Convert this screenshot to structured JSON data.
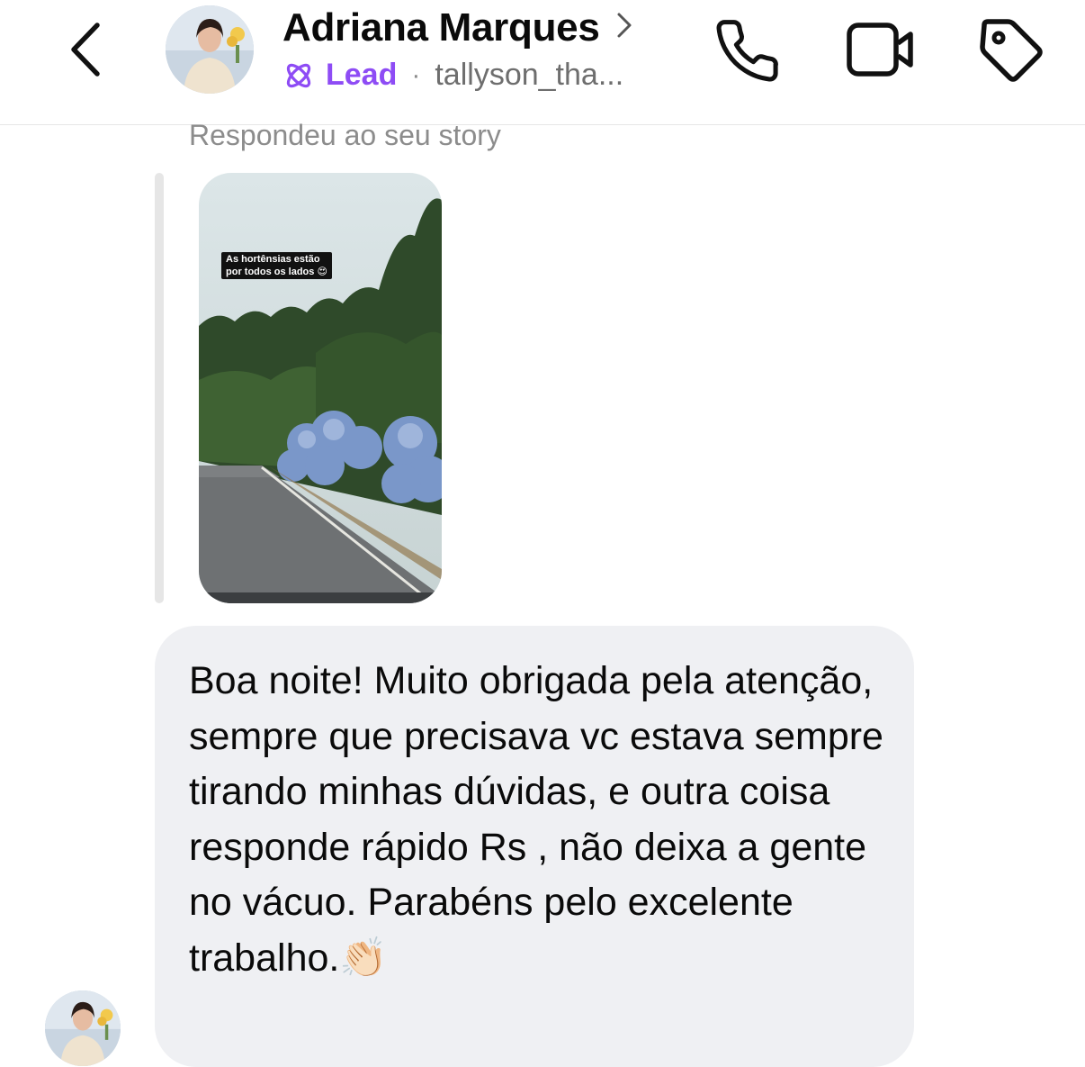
{
  "header": {
    "contact_name": "Adriana Marques",
    "label": "Lead",
    "username": "tallyson_tha...",
    "separator": "·",
    "icons": {
      "back": "chevron-left-icon",
      "profile_link": "chevron-right-icon",
      "label_icon": "atom-icon",
      "call": "phone-icon",
      "video": "video-camera-icon",
      "tag": "tag-icon"
    },
    "accent_color": "#8e4cf5"
  },
  "story_reply": {
    "label": "Respondeu ao seu story",
    "caption": "As hortênsias estão\npor todos os lados 😍"
  },
  "message": {
    "text": "Boa noite! Muito obrigada pela atenção, sempre que precisava vc estava sempre tirando minhas dúvidas, e outra coisa responde rápido Rs , não deixa a gente no vácuo. Parabéns pelo excelente trabalho.👏🏻",
    "bubble_color": "#eff0f3"
  }
}
